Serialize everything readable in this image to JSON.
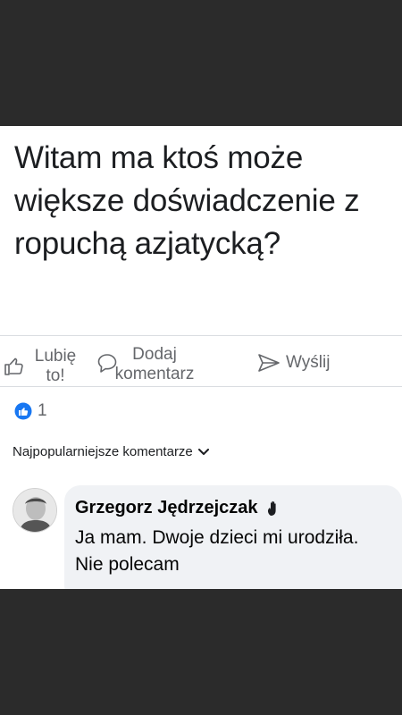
{
  "post": {
    "text": "Witam ma ktoś może większe doświadczenie z ropuchą azjatycką?"
  },
  "actions": {
    "like_label": "Lubię to!",
    "comment_label": "Dodaj komentarz",
    "send_label": "Wyślij"
  },
  "reactions": {
    "count": "1",
    "icon": "like-reaction-icon",
    "color": "#1877f2"
  },
  "comments_sort": {
    "label": "Najpopularniejsze komentarze",
    "icon": "chevron-down-icon"
  },
  "comment": {
    "author": "Grzegorz Jędrzejczak",
    "author_badge_icon": "waving-hand-icon",
    "text": "Ja mam. Dwoje dzieci mi urodziła. Nie polecam"
  }
}
